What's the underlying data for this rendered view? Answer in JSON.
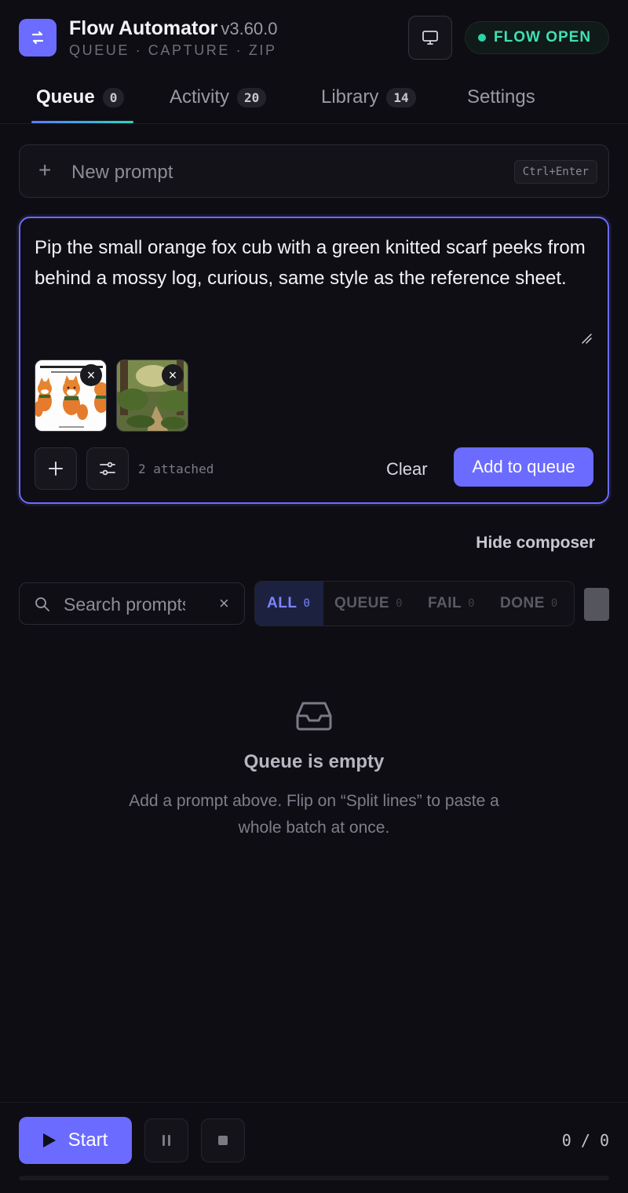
{
  "app": {
    "title": "Flow Automator",
    "version": "v3.60.0",
    "subtitle": "QUEUE · CAPTURE · ZIP",
    "logo_icon": "swap-arrows-icon",
    "status": "FLOW OPEN",
    "status_color": "#2dd4a8",
    "accent_color": "#6b6bff"
  },
  "tabs": [
    {
      "label": "Queue",
      "count": "0",
      "active": true
    },
    {
      "label": "Activity",
      "count": "20"
    },
    {
      "label": "Library",
      "count": "14"
    },
    {
      "label": "Settings"
    }
  ],
  "new_prompt": {
    "label": "New prompt",
    "shortcut": "Ctrl+Enter"
  },
  "composer": {
    "text": "Pip the small orange fox cub with a green knitted scarf peeks from behind a mossy log, curious, same style as the reference sheet.",
    "attachments": [
      {
        "name": "character-reference-sheet"
      },
      {
        "name": "forest-path-background"
      }
    ],
    "attached_label": "2 attached",
    "clear_label": "Clear",
    "add_label": "Add to queue"
  },
  "hide_composer_label": "Hide composer",
  "search": {
    "placeholder": "Search prompts",
    "clear_icon": "×"
  },
  "filters": [
    {
      "label": "ALL",
      "count": "0",
      "active": true
    },
    {
      "label": "QUEUE",
      "count": "0"
    },
    {
      "label": "FAIL",
      "count": "0"
    },
    {
      "label": "DONE",
      "count": "0"
    }
  ],
  "empty": {
    "title": "Queue is empty",
    "description": "Add a prompt above. Flip on “Split lines” to paste a whole batch at once."
  },
  "footer": {
    "start_label": "Start",
    "counter": "0 / 0",
    "progress": 0
  }
}
